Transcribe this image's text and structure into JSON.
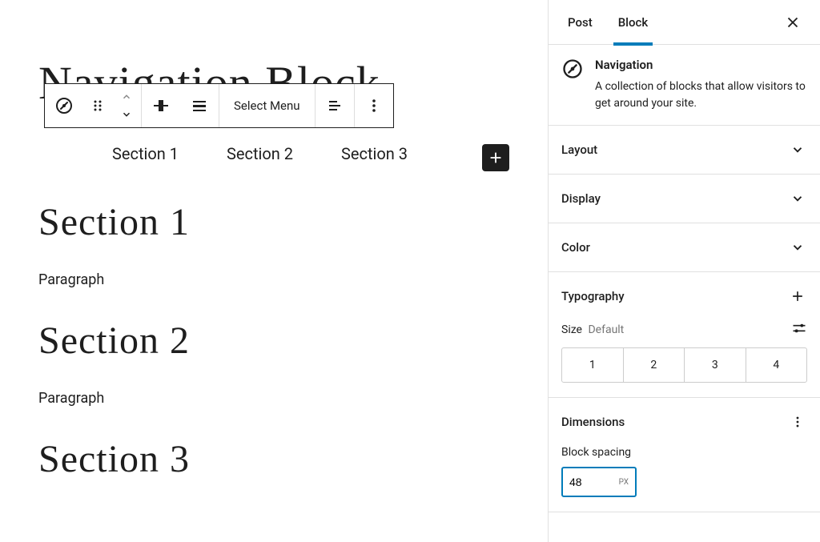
{
  "editor": {
    "page_title_bg": "Navigation Block",
    "toolbar": {
      "select_menu_label": "Select Menu"
    },
    "nav_items": [
      "Section 1",
      "Section 2",
      "Section 3"
    ],
    "sections": [
      {
        "heading": "Section 1",
        "paragraph": "Paragraph"
      },
      {
        "heading": "Section 2",
        "paragraph": "Paragraph"
      },
      {
        "heading": "Section 3",
        "paragraph": ""
      }
    ]
  },
  "sidebar": {
    "tabs": {
      "post": "Post",
      "block": "Block"
    },
    "block_info": {
      "title": "Navigation",
      "description": "A collection of blocks that allow visitors to get around your site."
    },
    "panels": {
      "layout": "Layout",
      "display": "Display",
      "color": "Color",
      "typography": "Typography",
      "dimensions": "Dimensions"
    },
    "typography": {
      "size_label": "Size",
      "size_default": "Default",
      "options": [
        "1",
        "2",
        "3",
        "4"
      ]
    },
    "dimensions": {
      "block_spacing_label": "Block spacing",
      "block_spacing_value": "48",
      "block_spacing_unit": "PX"
    }
  }
}
